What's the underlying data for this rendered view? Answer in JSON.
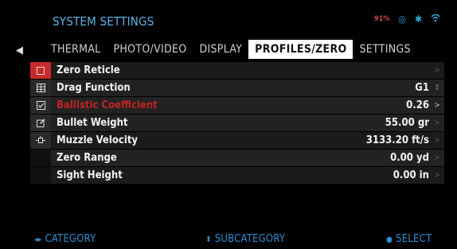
{
  "header": {
    "title": "SYSTEM SETTINGS",
    "battery": "91%",
    "status_icons": [
      "target-icon",
      "bluetooth-icon",
      "wifi-icon"
    ]
  },
  "tabs": [
    {
      "label": "THERMAL",
      "active": false
    },
    {
      "label": "PHOTO/VIDEO",
      "active": false
    },
    {
      "label": "DISPLAY",
      "active": false
    },
    {
      "label": "PROFILES/ZERO",
      "active": true
    },
    {
      "label": "SETTINGS",
      "active": false
    }
  ],
  "rows": [
    {
      "label": "Zero Reticle",
      "value": "",
      "icon": "checked-box-icon",
      "caret": ">"
    },
    {
      "label": "Drag Function",
      "value": "G1",
      "icon": "table-icon",
      "caret": "updown"
    },
    {
      "label": "Ballistic Coefficient",
      "value": "0.26",
      "icon": "edit-check-icon",
      "caret": ">"
    },
    {
      "label": "Bullet Weight",
      "value": "55.00 gr",
      "icon": "edit-icon",
      "caret": ">"
    },
    {
      "label": "Muzzle Velocity",
      "value": "3133.20 ft/s",
      "icon": "velocity-icon",
      "caret": ">"
    },
    {
      "label": "Zero Range",
      "value": "0.00 yd",
      "icon": "",
      "caret": ">"
    },
    {
      "label": "Sight Height",
      "value": "0.00 in",
      "icon": "",
      "caret": ">"
    }
  ],
  "footer": {
    "category": "CATEGORY",
    "subcategory": "SUBCATEGORY",
    "select": "SELECT"
  },
  "colors": {
    "title": "#5bb5e6",
    "selected_text": "#c22323",
    "checkbox": "#c62b2b",
    "footer": "#2e8fd0"
  }
}
